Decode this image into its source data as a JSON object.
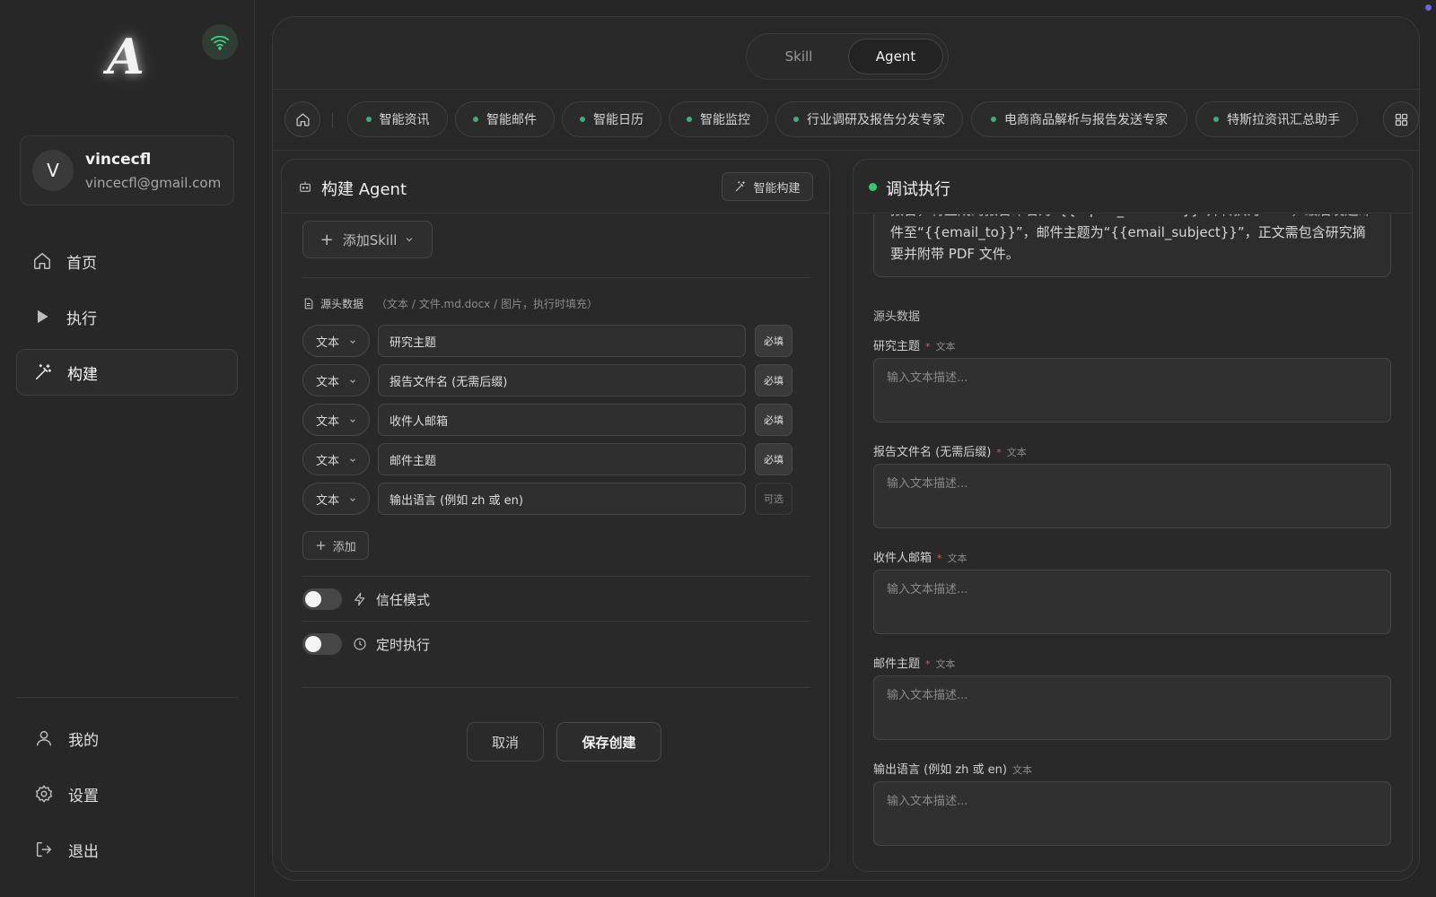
{
  "app": {
    "logo_letter": "A"
  },
  "user": {
    "avatar_letter": "V",
    "name": "vincecfl",
    "email": "vincecfl@gmail.com"
  },
  "nav": {
    "items": [
      {
        "label": "首页",
        "icon": "home-icon"
      },
      {
        "label": "执行",
        "icon": "play-icon"
      },
      {
        "label": "构建",
        "icon": "magic-wand-icon",
        "active": true
      }
    ],
    "bottom": [
      {
        "label": "我的",
        "icon": "user-icon"
      },
      {
        "label": "设置",
        "icon": "gear-icon"
      },
      {
        "label": "退出",
        "icon": "logout-icon"
      }
    ]
  },
  "mode_switch": {
    "skill": "Skill",
    "agent": "Agent",
    "selected": "Agent"
  },
  "agent_tabs": [
    "智能资讯",
    "智能邮件",
    "智能日历",
    "智能监控",
    "行业调研及报告分发专家",
    "电商商品解析与报告发送专家",
    "特斯拉资讯汇总助手"
  ],
  "colors": {
    "tab_dot": "#3cae7a",
    "status_dot": "#35c96d",
    "required_star": "#e0545a"
  },
  "build": {
    "title": "构建 Agent",
    "smart_build": "智能构建",
    "add_skill": "添加Skill",
    "source_label": "源头数据",
    "source_hint": "（文本 / 文件.md.docx / 图片，执行时填充）",
    "fields": [
      {
        "type": "文本",
        "value": "研究主题",
        "flag": "必填"
      },
      {
        "type": "文本",
        "value": "报告文件名 (无需后缀)",
        "flag": "必填"
      },
      {
        "type": "文本",
        "value": "收件人邮箱",
        "flag": "必填"
      },
      {
        "type": "文本",
        "value": "邮件主题",
        "flag": "必填"
      },
      {
        "type": "文本",
        "value": "输出语言 (例如 zh 或 en)",
        "flag": "可选"
      }
    ],
    "add_field": "添加",
    "trust_mode": {
      "label": "信任模式",
      "on": false
    },
    "schedule": {
      "label": "定时执行",
      "on": false
    },
    "cancel": "取消",
    "save": "保存创建"
  },
  "debug": {
    "title": "调试执行",
    "prompt_partial": "报告，将生成的报告命名为“{{report_filename}}”并转换为 PDF，最后发送邮件至“{{email_to}}”，邮件主题为“{{email_subject}}”，正文需包含研究摘要并附带 PDF 文件。",
    "source_section": "源头数据",
    "inputs": [
      {
        "label": "研究主题",
        "required": "*",
        "kind": "文本",
        "placeholder": "输入文本描述..."
      },
      {
        "label": "报告文件名 (无需后缀)",
        "required": "*",
        "kind": "文本",
        "placeholder": "输入文本描述..."
      },
      {
        "label": "收件人邮箱",
        "required": "*",
        "kind": "文本",
        "placeholder": "输入文本描述..."
      },
      {
        "label": "邮件主题",
        "required": "*",
        "kind": "文本",
        "placeholder": "输入文本描述..."
      },
      {
        "label": "输出语言 (例如 zh 或 en)",
        "required": "",
        "kind": "文本",
        "placeholder": "输入文本描述..."
      }
    ]
  }
}
